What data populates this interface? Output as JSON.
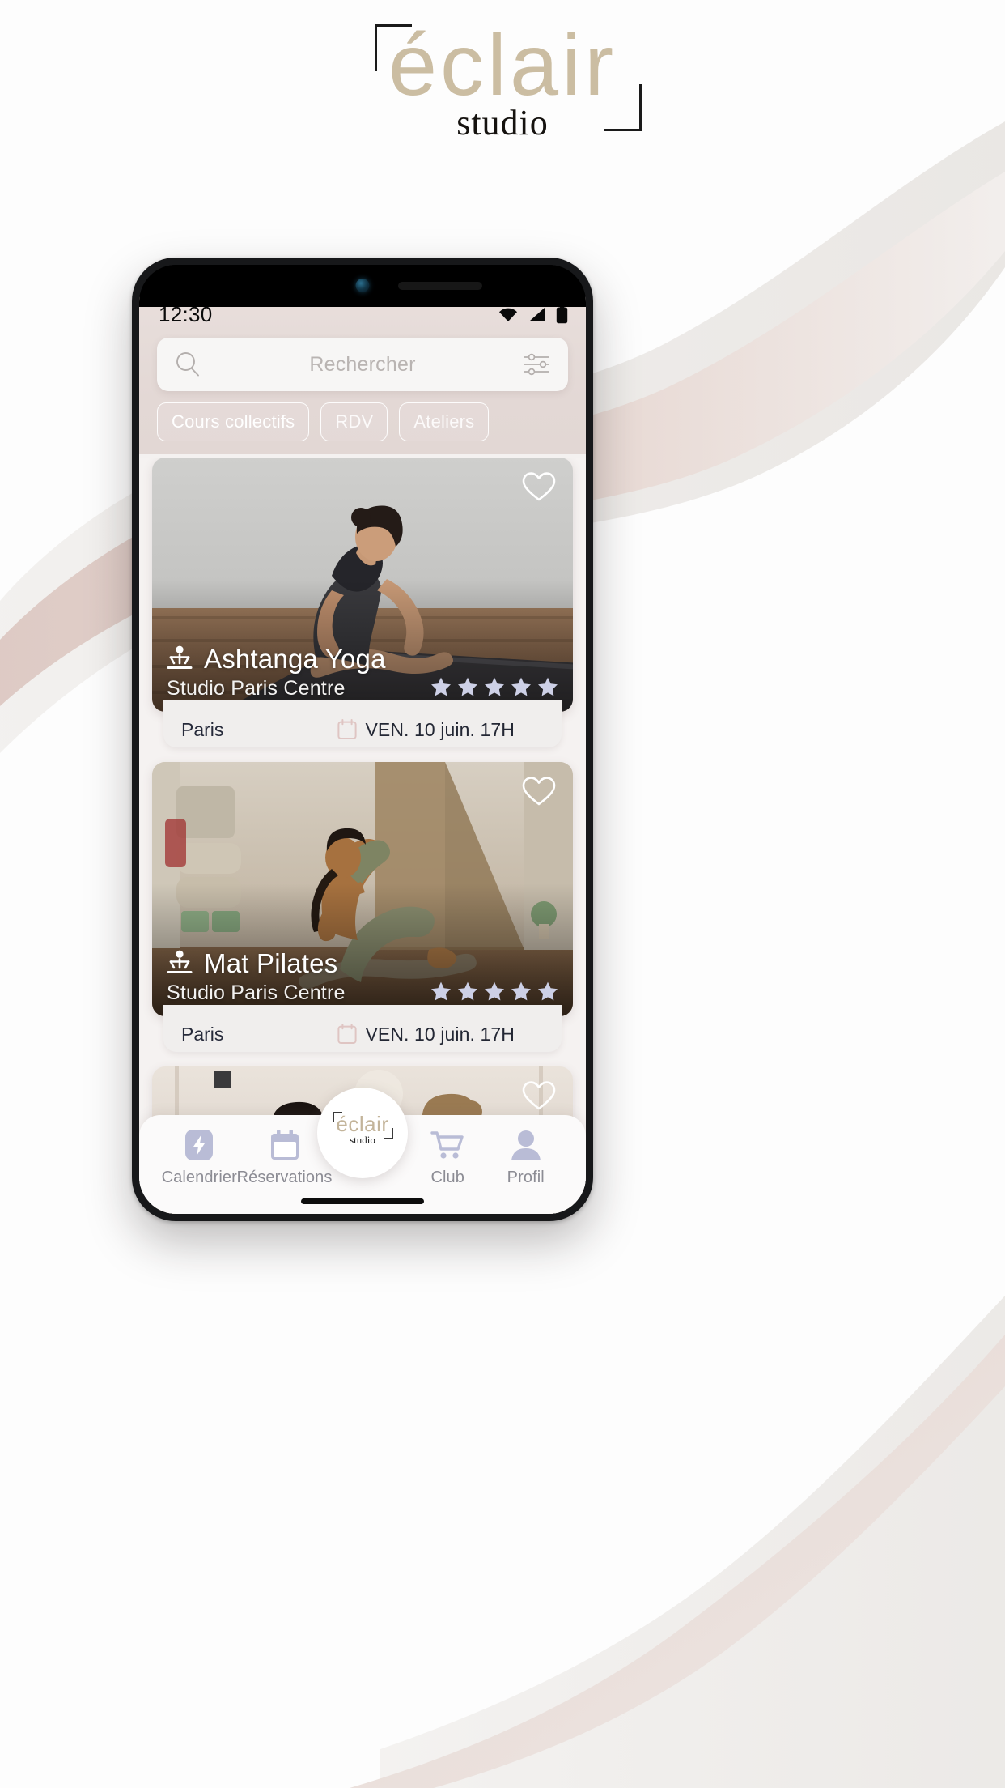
{
  "brand": {
    "word": "éclair",
    "sub": "studio",
    "accent_color": "#cbbda2",
    "bracket_color": "#1a1a1a"
  },
  "background": {
    "base_color": "#fdfdfd",
    "wave_rose": "#e0cdc7",
    "wave_grey": "#f0eeec"
  },
  "statusbar": {
    "time": "12:30",
    "icons": [
      "wifi-icon",
      "cellular-signal-icon",
      "battery-icon"
    ],
    "bg_color": "#e6dcd9"
  },
  "search": {
    "placeholder": "Rechercher",
    "left_icon": "search-icon",
    "right_icon": "filter-sliders-icon",
    "value": ""
  },
  "chips": [
    {
      "label": "Cours collectifs"
    },
    {
      "label": "RDV"
    },
    {
      "label": "Ateliers"
    }
  ],
  "cards": [
    {
      "title": "Ashtanga Yoga",
      "icon": "meditation-person-icon",
      "studio": "Studio Paris Centre",
      "rating": 5,
      "rating_max": 5,
      "place": "Paris",
      "date": "VEN. 10 juin. 17H",
      "date_icon": "calendar-icon",
      "favorite_icon": "heart-outline-icon",
      "favorited": false
    },
    {
      "title": "Mat Pilates",
      "icon": "meditation-person-icon",
      "studio": "Studio Paris Centre",
      "rating": 5,
      "rating_max": 5,
      "place": "Paris",
      "date": "VEN. 10 juin. 17H",
      "date_icon": "calendar-icon",
      "favorite_icon": "heart-outline-icon",
      "favorited": false
    },
    {
      "title": "",
      "icon": "",
      "studio": "",
      "rating": 0,
      "rating_max": 5,
      "place": "",
      "date": "",
      "date_icon": "calendar-icon",
      "favorite_icon": "heart-outline-icon",
      "favorited": false
    }
  ],
  "bottomnav": {
    "items": [
      {
        "label": "Calendrier",
        "icon": "lightning-bolt-icon"
      },
      {
        "label": "Réservations",
        "icon": "calendar-icon"
      },
      {
        "label": "Club",
        "icon": "shopping-cart-icon"
      },
      {
        "label": "Profil",
        "icon": "person-avatar-icon"
      }
    ],
    "fab": {
      "word": "éclair",
      "sub": "studio",
      "icon": "eclair-studio-logo-icon"
    },
    "icon_color": "#b9bcd6",
    "label_color": "#8c8c94"
  }
}
